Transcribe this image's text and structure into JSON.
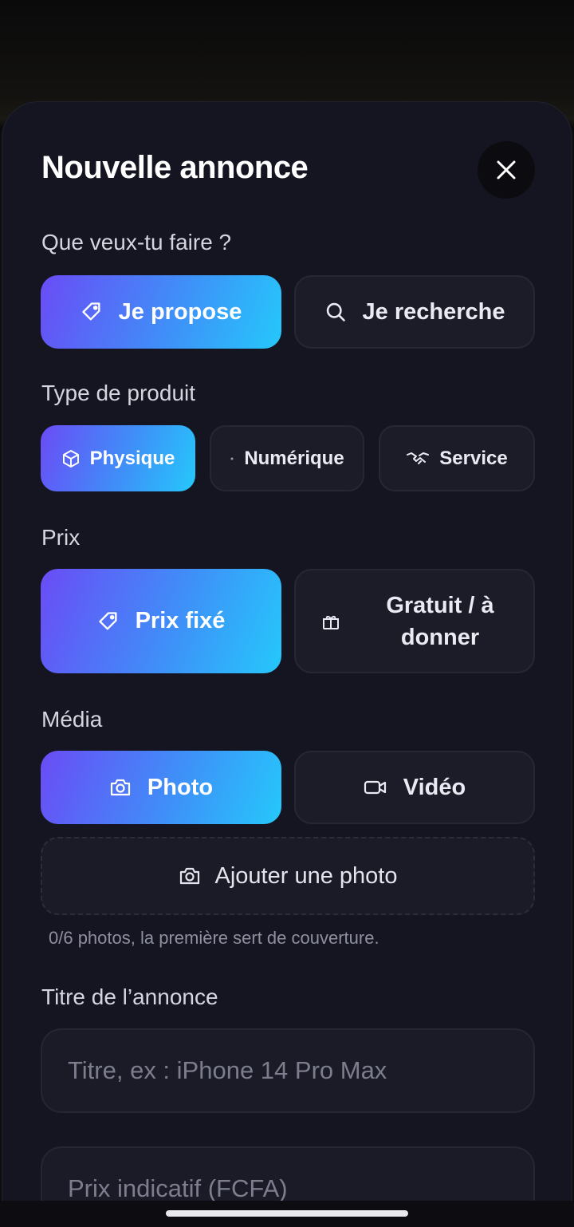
{
  "sheet": {
    "title": "Nouvelle annonce",
    "close_icon": "close-icon"
  },
  "intent": {
    "label": "Que veux-tu faire ?",
    "options": [
      {
        "label": "Je propose",
        "icon": "tag-icon",
        "selected": true
      },
      {
        "label": "Je recherche",
        "icon": "search-icon",
        "selected": false
      }
    ]
  },
  "product_type": {
    "label": "Type de produit",
    "options": [
      {
        "label": "Physique",
        "icon": "box-icon",
        "selected": true
      },
      {
        "label": "Numérique",
        "icon": "dot-icon",
        "selected": false
      },
      {
        "label": "Service",
        "icon": "handshake-icon",
        "selected": false
      }
    ]
  },
  "price": {
    "label": "Prix",
    "options": [
      {
        "label": "Prix fixé",
        "icon": "tag-icon",
        "selected": true
      },
      {
        "label": "Gratuit / à donner",
        "icon": "gift-icon",
        "selected": false
      }
    ]
  },
  "media": {
    "label": "Média",
    "options": [
      {
        "label": "Photo",
        "icon": "camera-icon",
        "selected": true
      },
      {
        "label": "Vidéo",
        "icon": "video-icon",
        "selected": false
      }
    ],
    "add_photo_label": "Ajouter une photo",
    "hint": "0/6 photos, la première sert de couverture."
  },
  "title_field": {
    "label": "Titre de l’annonce",
    "placeholder": "Titre, ex : iPhone 14 Pro Max"
  },
  "price_field": {
    "placeholder": "Prix indicatif (FCFA)"
  },
  "colors": {
    "accent_gradient_start": "#6a4cf6",
    "accent_gradient_end": "#25c8fb",
    "sheet_bg": "#141520",
    "option_bg": "#1b1c28"
  }
}
